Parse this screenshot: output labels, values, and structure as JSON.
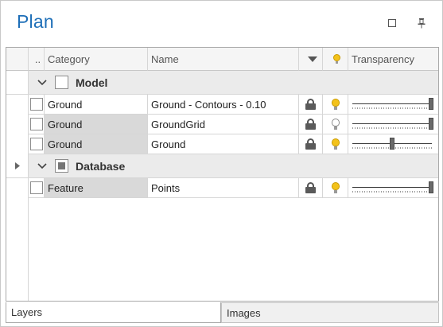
{
  "panel": {
    "title": "Plan",
    "maximize_icon": "maximize-icon",
    "pin_icon": "pin-icon"
  },
  "columns": {
    "selector": "..",
    "category": "Category",
    "name": "Name",
    "lock_filter_icon": "dropdown-arrow-icon",
    "visibility_icon": "lightbulb-icon",
    "transparency": "Transparency"
  },
  "groups": [
    {
      "label": "Model",
      "expanded": true,
      "checkbox_state": "unchecked",
      "rows": [
        {
          "category": "Ground",
          "name": "Ground - Contours - 0.10",
          "locked": true,
          "visible": true,
          "category_shaded": false,
          "transparency": 1.0
        },
        {
          "category": "Ground",
          "name": "GroundGrid",
          "locked": true,
          "visible": false,
          "category_shaded": true,
          "transparency": 1.0
        },
        {
          "category": "Ground",
          "name": "Ground",
          "locked": true,
          "visible": true,
          "category_shaded": true,
          "transparency": 0.5
        }
      ]
    },
    {
      "label": "Database",
      "expanded": true,
      "checkbox_state": "indeterminate",
      "rows": [
        {
          "category": "Feature",
          "name": "Points",
          "locked": true,
          "visible": true,
          "category_shaded": true,
          "transparency": 1.0
        }
      ]
    }
  ],
  "tabs": [
    {
      "label": "Layers",
      "active": true
    },
    {
      "label": "Images",
      "active": false
    }
  ],
  "colors": {
    "title": "#1e6fb8",
    "bulb_on": "#f3c21a",
    "group_bg": "#ebebeb",
    "shaded_cell": "#d9d9d9"
  }
}
